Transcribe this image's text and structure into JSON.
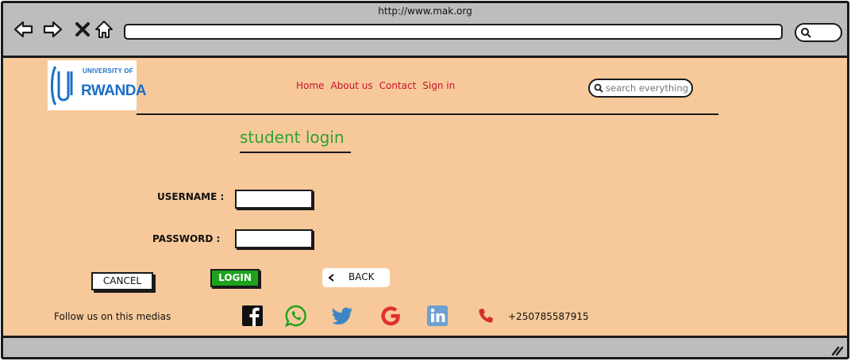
{
  "browser": {
    "url": "http://www.mak.org"
  },
  "logo": {
    "line1": "UNIVERSITY OF",
    "line2": "RWANDA",
    "color": "#1b6fc6"
  },
  "nav": {
    "items": [
      "Home",
      "About us",
      "Contact",
      "Sign in"
    ],
    "color": "#c8102e"
  },
  "search": {
    "placeholder": "search everything"
  },
  "page": {
    "title": "student login",
    "title_color": "#2fa12f",
    "background": "#f7c99a"
  },
  "form": {
    "username_label": "USERNAME :",
    "username_value": "",
    "password_label": "PASSWORD :",
    "password_value": "",
    "cancel_label": "CANCEL",
    "login_label": "LOGIN",
    "back_label": "BACK"
  },
  "footer": {
    "follow_text": "Follow us on this medias",
    "social_icons": [
      "facebook-icon",
      "whatsapp-icon",
      "twitter-icon",
      "google-icon",
      "linkedin-icon"
    ],
    "phone_icon": "phone-icon",
    "phone": "+250785587915"
  }
}
